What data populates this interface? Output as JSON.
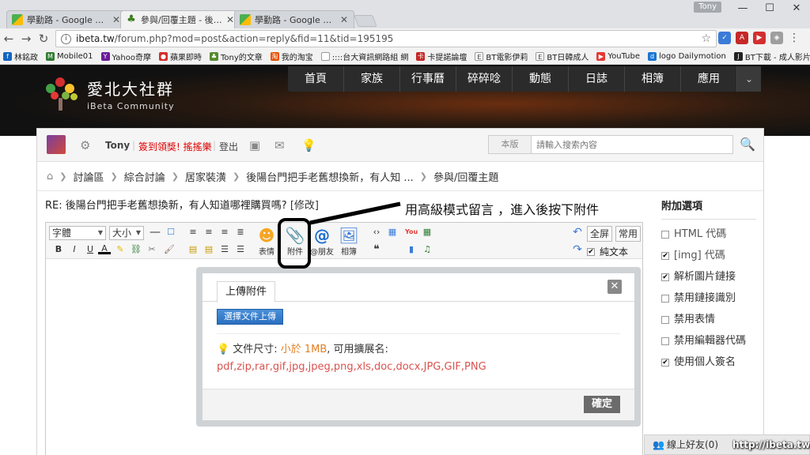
{
  "browser": {
    "tabs": [
      {
        "title": "學勤路 - Google 地圖"
      },
      {
        "title": "參與/回覆主題 - 後陽台門"
      },
      {
        "title": "學勤路 - Google 地圖"
      }
    ],
    "profile": "Tony",
    "url_host": "ibeta.tw",
    "url_path": "/forum.php?mod=post&action=reply&fid=11&tid=195195",
    "bookmarks": [
      "林銘政",
      "Mobile01",
      "Yahoo奇摩",
      "蘋果即時",
      "Tony的文章",
      "我的淘宝",
      "::::台大資訊網路組 網",
      "卡提諾論壇",
      "BT電影伊莉",
      "BT日韓成人",
      "YouTube",
      "logo Dailymotion",
      "BT下載 - 成人影片 - 歐"
    ]
  },
  "site": {
    "name_cn": "愛北大社群",
    "name_en": "iBeta Community",
    "nav": [
      "首頁",
      "家族",
      "行事曆",
      "碎碎唸",
      "動態",
      "日誌",
      "相簿",
      "應用"
    ]
  },
  "userbar": {
    "username": "Tony",
    "promo": "簽到領獎! 搖搖樂",
    "logout": "登出",
    "search_scope": "本版",
    "search_placeholder": "請輸入搜索內容"
  },
  "breadcrumb": [
    "討論區",
    "綜合討論",
    "居家裝潢",
    "後陽台門把手老舊想換新，有人知 ...",
    "參與/回覆主題"
  ],
  "reply": {
    "title": "RE: 後陽台門把手老舊想換新，有人知道哪裡購買嗎?",
    "edit_link": "[修改]"
  },
  "editor": {
    "font_select": "字體",
    "size_select": "大小",
    "tools": {
      "emoji": "表情",
      "attach": "附件",
      "mention": "@朋友",
      "album": "相簿"
    },
    "fullscreen": "全屏",
    "common": "常用",
    "plain_text": "純文本"
  },
  "annotation": "用高級模式留言 ，進入後按下附件",
  "dialog": {
    "tab": "上傳附件",
    "choose_button": "選擇文件上傳",
    "size_label": "文件尺寸:",
    "size_value": "小於 1MB",
    "ext_label": ", 可用擴展名:",
    "extensions": "pdf,zip,rar,gif,jpg,jpeg,png,xls,doc,docx,JPG,GIF,PNG",
    "ok_button": "確定"
  },
  "options": {
    "title": "附加選項",
    "items": [
      {
        "label": "HTML 代碼",
        "checked": false,
        "disabled": true
      },
      {
        "label": "[img] 代碼",
        "checked": true,
        "disabled": true
      },
      {
        "label": "解析圖片鏈接",
        "checked": true,
        "disabled": false
      },
      {
        "label": "禁用鏈接識別",
        "checked": false,
        "disabled": false
      },
      {
        "label": "禁用表情",
        "checked": false,
        "disabled": false
      },
      {
        "label": "禁用編輯器代碼",
        "checked": false,
        "disabled": false
      },
      {
        "label": "使用個人簽名",
        "checked": true,
        "disabled": false
      }
    ]
  },
  "friends": "線上好友(0)",
  "watermark": "http://ibeta.tw"
}
